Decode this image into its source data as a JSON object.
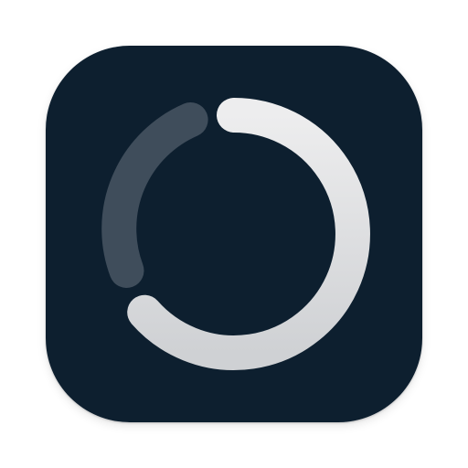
{
  "app_icon": {
    "background_color": "#0d1f2f",
    "ring": {
      "foreground_gradient_top": "#ededee",
      "foreground_gradient_bottom": "#cfd1d4",
      "background_arc_color": "#3f4d5b"
    },
    "icons": {
      "icon": "progress-ring-icon",
      "foreground_arc": "progress-arc",
      "background_arc": "track-arc"
    }
  }
}
